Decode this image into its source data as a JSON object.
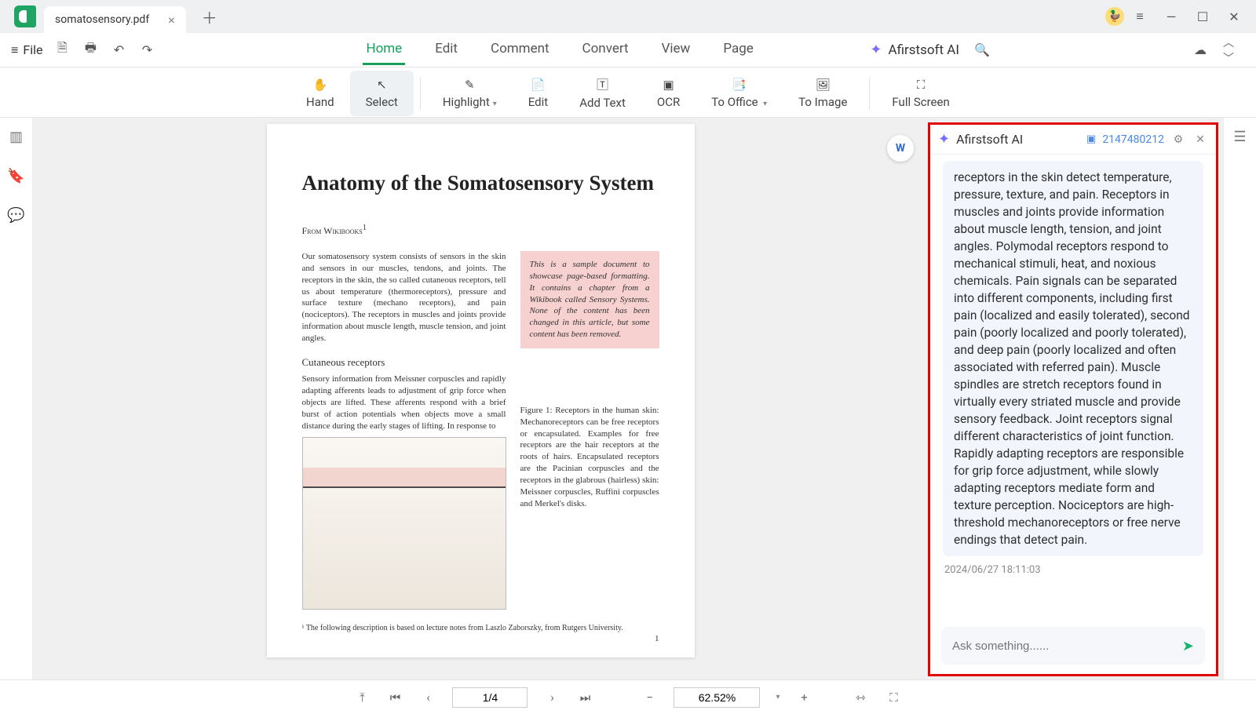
{
  "tab": {
    "title": "somatosensory.pdf"
  },
  "file_menu": {
    "label": "File"
  },
  "menu": {
    "home": "Home",
    "edit": "Edit",
    "comment": "Comment",
    "convert": "Convert",
    "view": "View",
    "page": "Page"
  },
  "ai_brand": "Afirstsoft AI",
  "tools": {
    "hand": "Hand",
    "select": "Select",
    "highlight": "Highlight",
    "edit": "Edit",
    "add_text": "Add Text",
    "ocr": "OCR",
    "to_office": "To Office",
    "to_image": "To Image",
    "full_screen": "Full Screen"
  },
  "document": {
    "title": "Anatomy of the Somatosensory System",
    "source": "From Wikibooks",
    "intro": "Our somatosensory system consists of sensors in the skin and sensors in our muscles, tendons, and joints. The receptors in the skin, the so called cutaneous receptors, tell us about temperature (thermoreceptors), pressure and surface texture (mechano receptors), and pain (nociceptors). The receptors in muscles and joints provide information about muscle length, muscle tension, and joint angles.",
    "callout": "This is a sample document to showcase page-based formatting. It contains a chapter from a Wikibook called Sensory Systems. None of the content has been changed in this article, but some content has been removed.",
    "sub1": "Cutaneous receptors",
    "body1": "Sensory information from Meissner corpuscles and rapidly adapting afferents leads to adjustment of grip force when objects are lifted. These afferents respond with a brief burst of action potentials when objects move a small distance during the early stages of lifting. In response to",
    "fig_caption": "Figure 1:  Receptors in the human skin: Mechanoreceptors can be free receptors or encapsulated. Examples for free receptors are the hair receptors at the roots of hairs. Encapsulated receptors are the Pacinian corpuscles and the receptors in the glabrous (hairless) skin: Meissner corpuscles, Ruffini corpuscles and Merkel's disks.",
    "footnote": "¹ The following description is based on lecture notes from Laszlo Zaborszky, from Rutgers University.",
    "page_number": "1"
  },
  "ai_panel": {
    "title": "Afirstsoft AI",
    "number": "2147480212",
    "message": "receptors in the skin detect temperature, pressure, texture, and pain. Receptors in muscles and joints provide information about muscle length, tension, and joint angles. Polymodal receptors respond to mechanical stimuli, heat, and noxious chemicals. Pain signals can be separated into different components, including first pain (localized and easily tolerated), second pain (poorly localized and poorly tolerated), and deep pain (poorly localized and often associated with referred pain). Muscle spindles are stretch receptors found in virtually every striated muscle and provide sensory feedback. Joint receptors signal different characteristics of joint function. Rapidly adapting receptors are responsible for grip force adjustment, while slowly adapting receptors mediate form and texture perception. Nociceptors are high-threshold mechanoreceptors or free nerve endings that detect pain.",
    "timestamp": "2024/06/27 18:11:03",
    "placeholder": "Ask something......"
  },
  "status": {
    "page": "1/4",
    "zoom": "62.52%"
  }
}
